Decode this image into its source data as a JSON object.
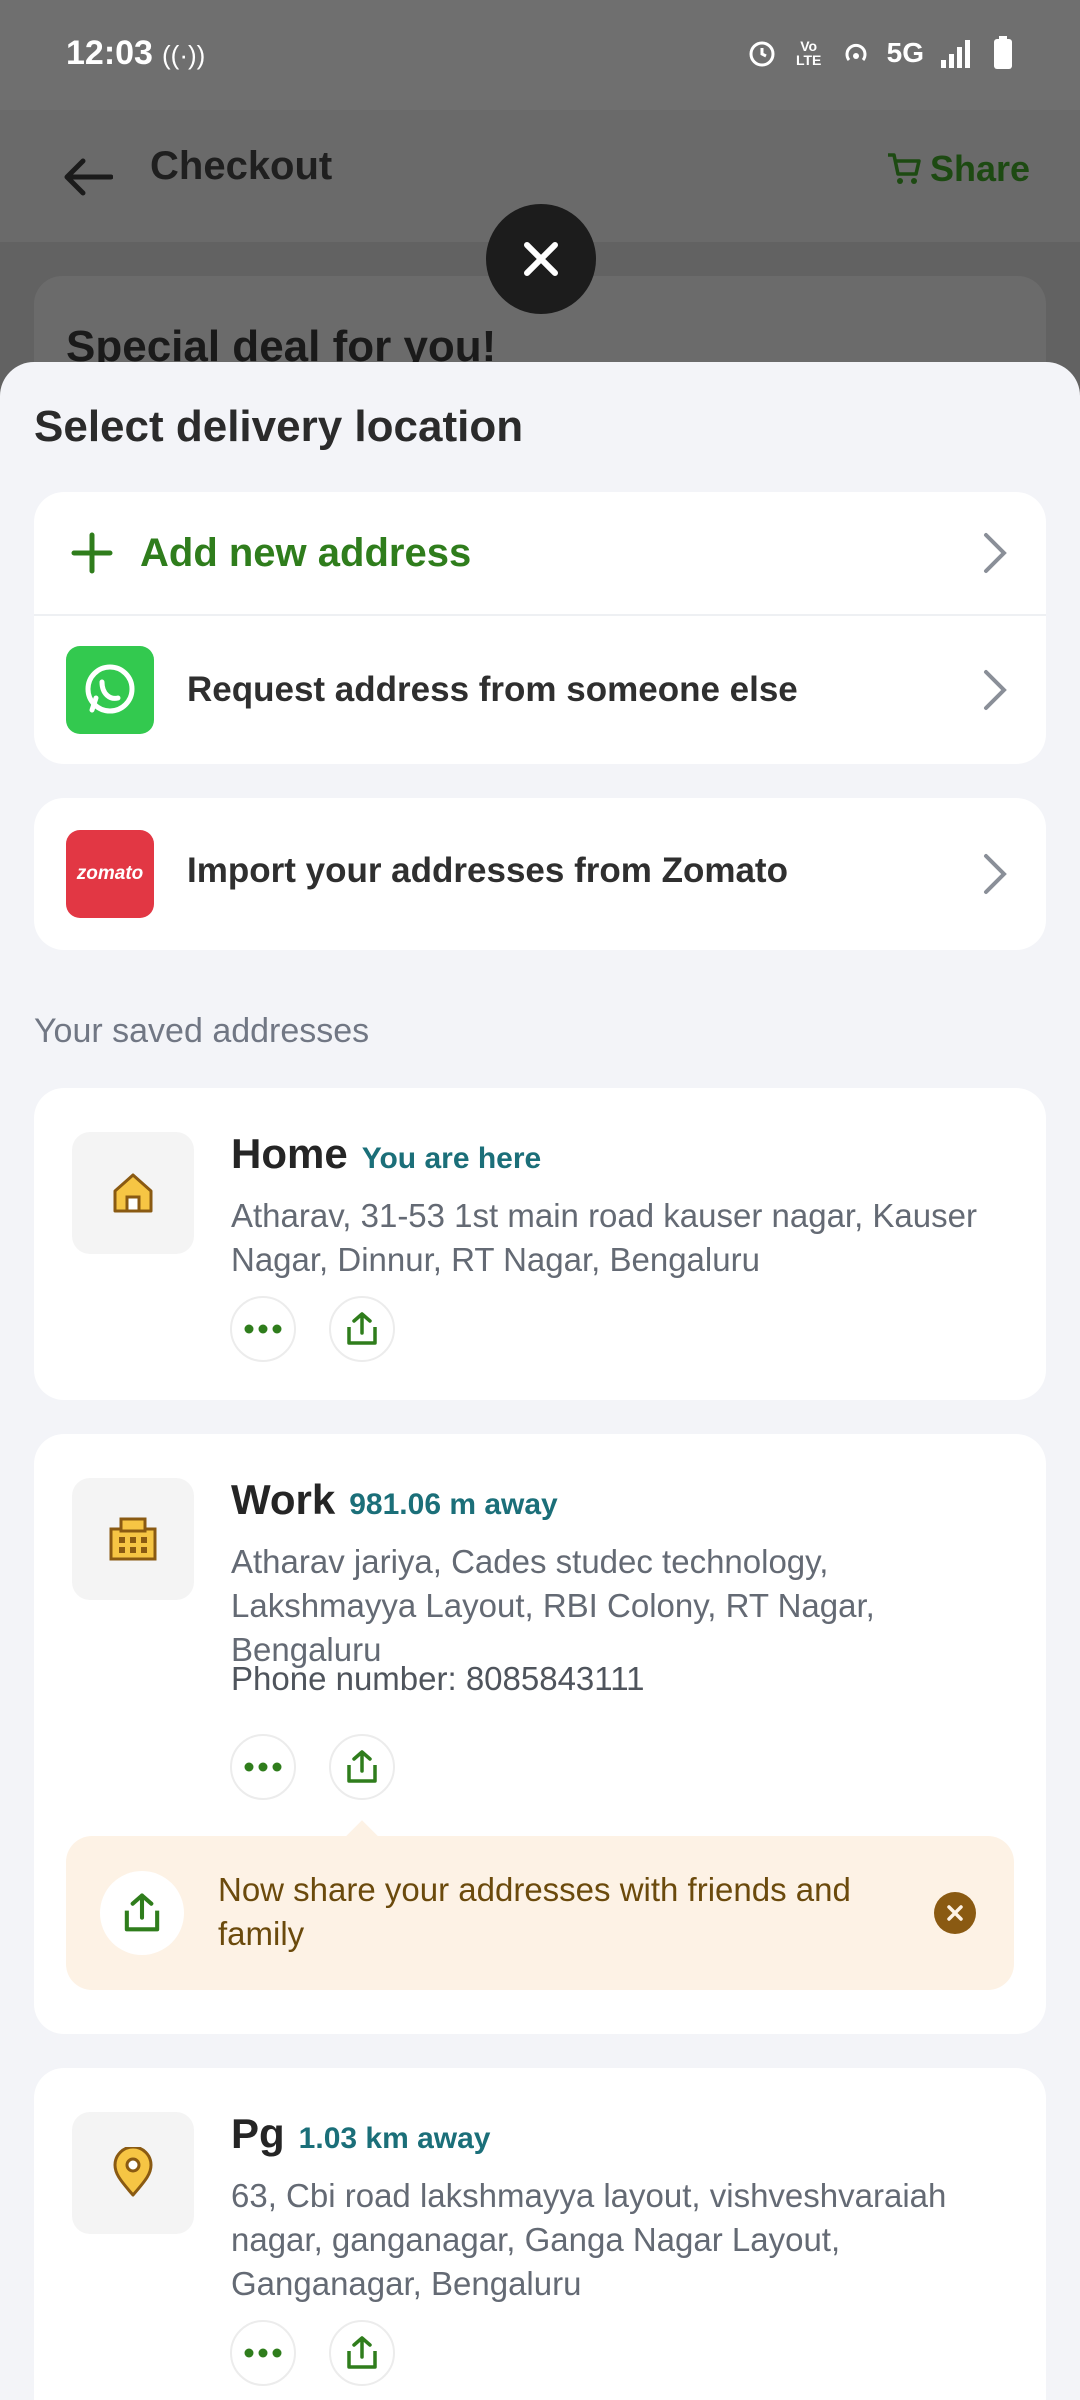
{
  "status_bar": {
    "time": "12:03",
    "hotspot_glyph": "((·))",
    "network": "5G",
    "lte_label": "Vo LTE",
    "icons": [
      "alarm-icon",
      "volte-icon",
      "hotspot-icon",
      "signal-icon",
      "battery-icon"
    ]
  },
  "app_bar": {
    "title": "Checkout",
    "share_label": "Share",
    "share_icon": "cart-icon"
  },
  "background": {
    "deal_title": "Special deal for you!"
  },
  "sheet": {
    "title": "Select delivery location",
    "add_address_label": "Add new address",
    "request_address_label": "Request address from someone else",
    "import_label": "Import your addresses from Zomato",
    "zomato_logo_text": "zomato",
    "saved_label": "Your saved addresses"
  },
  "addresses": [
    {
      "name": "Home",
      "distance": "You are here",
      "icon": "home-icon",
      "address": "Atharav, 31-53 1st main road kauser nagar, Kauser Nagar, Dinnur, RT Nagar, Bengaluru"
    },
    {
      "name": "Work",
      "distance": "981.06 m away",
      "icon": "building-icon",
      "address": "Atharav jariya, Cades studec technology, Lakshmayya Layout, RBI Colony, RT Nagar, Bengaluru",
      "phone": "Phone number: 8085843111"
    },
    {
      "name": "Pg",
      "distance": "1.03 km away",
      "icon": "location-pin-icon",
      "address": "63, Cbi road lakshmayya layout, vishveshvaraiah nagar, ganganagar, Ganga Nagar Layout, Ganganagar, Bengaluru"
    }
  ],
  "share_tip": {
    "text": "Now share your addresses with friends and family"
  },
  "colors": {
    "brand_green": "#2f7d1c",
    "teal_text": "#1b6f79",
    "tip_bg": "#fdf2e5",
    "zomato_red": "#e23744",
    "whatsapp_green": "#33c94f"
  }
}
